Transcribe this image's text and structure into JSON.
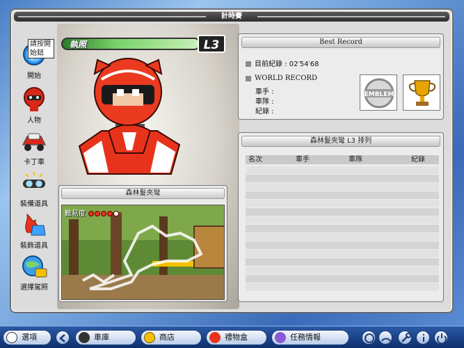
{
  "window": {
    "title": "計時賽"
  },
  "sidebar": {
    "tooltip": "請按開始鈕",
    "items": [
      {
        "label": "開始",
        "icon": "start-arrow-icon"
      },
      {
        "label": "人物",
        "icon": "character-icon"
      },
      {
        "label": "卡丁車",
        "icon": "kart-icon"
      },
      {
        "label": "裝備道具",
        "icon": "goggles-icon"
      },
      {
        "label": "裝飾道具",
        "icon": "flame-shirt-icon"
      },
      {
        "label": "選擇駕照",
        "icon": "license-globe-icon"
      }
    ]
  },
  "license": {
    "label": "執照",
    "level": "L3"
  },
  "track": {
    "title": "森林髮夾彎",
    "difficulty_label": "難易度",
    "difficulty_value": 4,
    "difficulty_max": 5
  },
  "best_record": {
    "title": "Best Record",
    "current_label": "目前紀錄",
    "current_value": "02′54′68",
    "world_label": "WORLD RECORD",
    "driver_label": "車手 :",
    "team_label": "車隊 :",
    "record_label": "紀錄 :",
    "emblem_text": "EMBLEM"
  },
  "ranking": {
    "title": "森林髮夾彎 L3 排列",
    "columns": [
      "名次",
      "車手",
      "車隊",
      "紀錄"
    ],
    "rows": []
  },
  "taskbar": {
    "options": "選項",
    "garage": "車庫",
    "shop": "商店",
    "gift": "禮物盒",
    "missions": "任務情報"
  },
  "colors": {
    "accent": "#2b5aa8",
    "license_green": "#2e7a2a",
    "kart_red": "#e8331c"
  }
}
